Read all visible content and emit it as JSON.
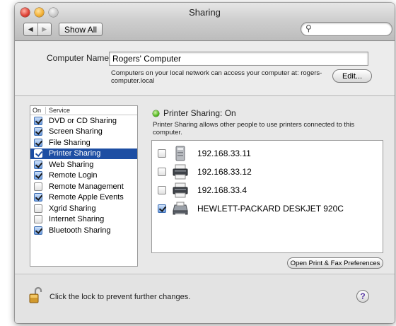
{
  "window": {
    "title": "Sharing"
  },
  "toolbar": {
    "show_all_label": "Show All",
    "search_placeholder": ""
  },
  "computer": {
    "name_label": "Computer Name:",
    "name_value": "Rogers' Computer",
    "note": "Computers on your local network can access your computer at: rogers-computer.local",
    "edit_label": "Edit..."
  },
  "services": {
    "header_on": "On",
    "header_service": "Service",
    "items": [
      {
        "label": "DVD or CD Sharing",
        "on": true,
        "selected": false
      },
      {
        "label": "Screen Sharing",
        "on": true,
        "selected": false
      },
      {
        "label": "File Sharing",
        "on": true,
        "selected": false
      },
      {
        "label": "Printer Sharing",
        "on": true,
        "selected": true
      },
      {
        "label": "Web Sharing",
        "on": true,
        "selected": false
      },
      {
        "label": "Remote Login",
        "on": true,
        "selected": false
      },
      {
        "label": "Remote Management",
        "on": false,
        "selected": false
      },
      {
        "label": "Remote Apple Events",
        "on": true,
        "selected": false
      },
      {
        "label": "Xgrid Sharing",
        "on": false,
        "selected": false
      },
      {
        "label": "Internet Sharing",
        "on": false,
        "selected": false
      },
      {
        "label": "Bluetooth Sharing",
        "on": true,
        "selected": false
      }
    ]
  },
  "status": {
    "text": "Printer Sharing: On",
    "description": "Printer Sharing allows other people to use printers connected to this computer.",
    "color": "#52b81f"
  },
  "printers": [
    {
      "name": "192.168.33.11",
      "shared": false,
      "icon": "tower-printer-icon"
    },
    {
      "name": "192.168.33.12",
      "shared": false,
      "icon": "printer-icon"
    },
    {
      "name": "192.168.33.4",
      "shared": false,
      "icon": "printer-icon"
    },
    {
      "name": "HEWLETT-PACKARD DESKJET 920C",
      "shared": true,
      "icon": "inkjet-printer-icon"
    }
  ],
  "open_prefs_label": "Open Print & Fax Preferences",
  "footer": {
    "lock_text": "Click the lock to prevent further changes.",
    "help_label": "?"
  },
  "colors": {
    "selection": "#1d4ea3",
    "status_green": "#52b81f"
  }
}
